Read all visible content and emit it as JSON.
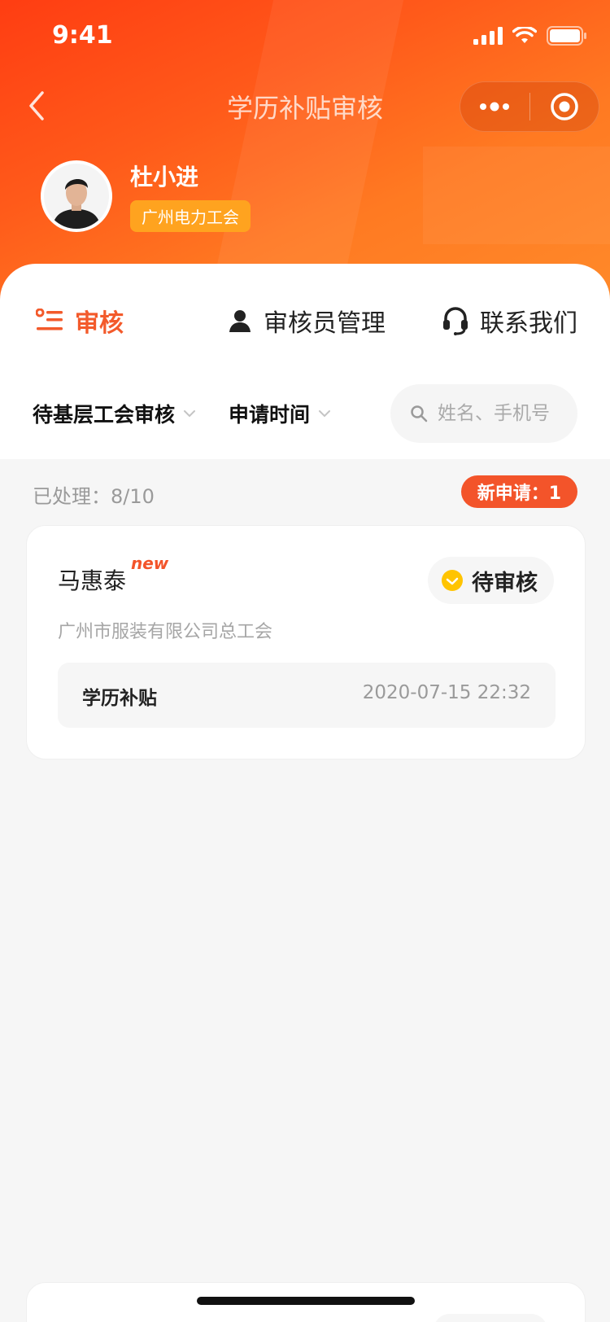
{
  "status_bar": {
    "time": "9:41"
  },
  "nav": {
    "title": "学历补贴审核"
  },
  "profile": {
    "name": "杜小进",
    "org": "广州电力工会"
  },
  "tabs": [
    {
      "label": "审核",
      "icon": "list-check-icon",
      "active": true
    },
    {
      "label": "审核员管理",
      "icon": "person-icon",
      "active": false
    },
    {
      "label": "联系我们",
      "icon": "headset-icon",
      "active": false
    }
  ],
  "filters": {
    "status": "待基层工会审核",
    "time": "申请时间",
    "search_placeholder": "姓名、手机号"
  },
  "stats": {
    "processed": "已处理：8/10",
    "new_applications": "新申请：1"
  },
  "applications": [
    {
      "name": "马惠泰",
      "new_mark": "new",
      "status": "待审核",
      "company": "广州市服装有限公司总工会",
      "type": "学历补贴",
      "time": "2020-07-15 22:32"
    }
  ],
  "colors": {
    "accent": "#f35a2b",
    "tag": "#ffa31f",
    "pending": "#ffc400"
  }
}
